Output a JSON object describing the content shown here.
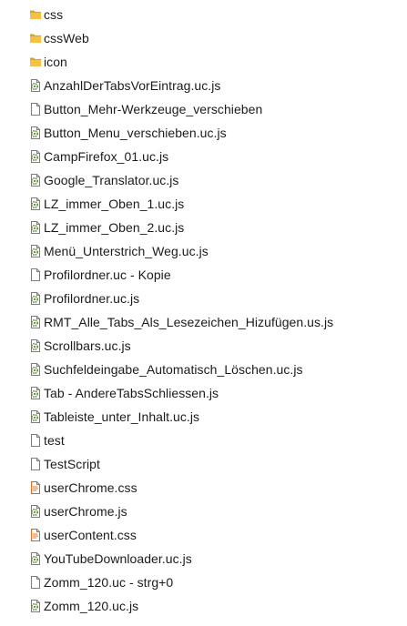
{
  "files": [
    {
      "name": "css",
      "icon": "folder-icon"
    },
    {
      "name": "cssWeb",
      "icon": "folder-icon"
    },
    {
      "name": "icon",
      "icon": "folder-icon"
    },
    {
      "name": "AnzahlDerTabsVorEintrag.uc.js",
      "icon": "script-file-icon"
    },
    {
      "name": "Button_Mehr-Werkzeuge_verschieben",
      "icon": "blank-file-icon"
    },
    {
      "name": "Button_Menu_verschieben.uc.js",
      "icon": "script-file-icon"
    },
    {
      "name": "CampFirefox_01.uc.js",
      "icon": "script-file-icon"
    },
    {
      "name": "Google_Translator.uc.js",
      "icon": "script-file-icon"
    },
    {
      "name": "LZ_immer_Oben_1.uc.js",
      "icon": "script-file-icon"
    },
    {
      "name": "LZ_immer_Oben_2.uc.js",
      "icon": "script-file-icon"
    },
    {
      "name": "Menü_Unterstrich_Weg.uc.js",
      "icon": "script-file-icon"
    },
    {
      "name": "Profilordner.uc - Kopie",
      "icon": "blank-file-icon"
    },
    {
      "name": "Profilordner.uc.js",
      "icon": "script-file-icon"
    },
    {
      "name": "RMT_Alle_Tabs_Als_Lesezeichen_Hizufügen.us.js",
      "icon": "script-file-icon"
    },
    {
      "name": "Scrollbars.uc.js",
      "icon": "script-file-icon"
    },
    {
      "name": "Suchfeldeingabe_Automatisch_Löschen.uc.js",
      "icon": "script-file-icon"
    },
    {
      "name": "Tab - AndereTabsSchliessen.js",
      "icon": "script-file-icon"
    },
    {
      "name": "Tableiste_unter_Inhalt.uc.js",
      "icon": "script-file-icon"
    },
    {
      "name": "test",
      "icon": "blank-file-icon"
    },
    {
      "name": "TestScript",
      "icon": "blank-file-icon"
    },
    {
      "name": "userChrome.css",
      "icon": "css-file-icon"
    },
    {
      "name": "userChrome.js",
      "icon": "script-file-icon"
    },
    {
      "name": "userContent.css",
      "icon": "css-file-icon"
    },
    {
      "name": "YouTubeDownloader.uc.js",
      "icon": "script-file-icon"
    },
    {
      "name": "Zomm_120.uc - strg+0",
      "icon": "blank-file-icon"
    },
    {
      "name": "Zomm_120.uc.js",
      "icon": "script-file-icon"
    }
  ],
  "colors": {
    "folder": "#f6c142",
    "folder_dark": "#e3a21a",
    "page": "#ffffff",
    "page_border": "#7d7d7d",
    "script_gear": "#5a8f2e",
    "css_lines": "#e07b24",
    "text": "#1b1b1b"
  }
}
